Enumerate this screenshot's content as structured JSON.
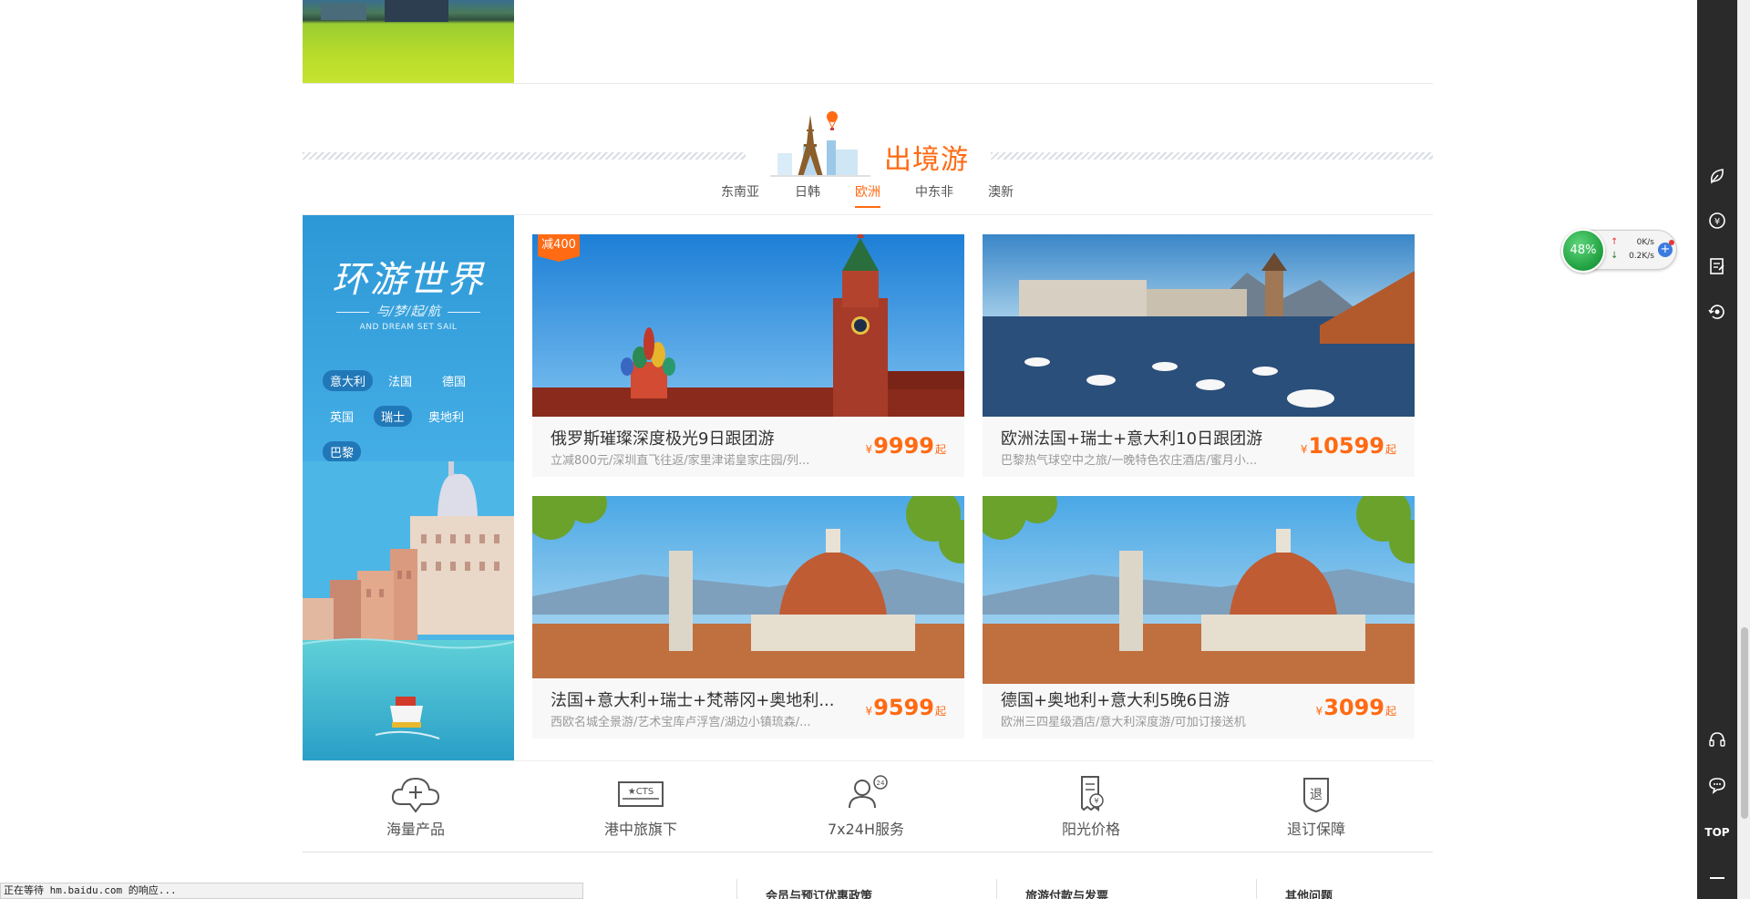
{
  "section": {
    "title": "出境游",
    "tabs": [
      {
        "label": "东南亚"
      },
      {
        "label": "日韩"
      },
      {
        "label": "欧洲",
        "active": true
      },
      {
        "label": "中东非"
      },
      {
        "label": "澳新"
      }
    ]
  },
  "promo": {
    "title": "环游世界",
    "subtitle": "与/梦/起/航",
    "subtitle_en": "AND DREAM SET SAIL",
    "tags": [
      {
        "label": "意大利",
        "selected": true
      },
      {
        "label": "法国"
      },
      {
        "label": "德国"
      },
      {
        "label": "英国"
      },
      {
        "label": "瑞士",
        "selected": true
      },
      {
        "label": "奥地利"
      },
      {
        "label": "巴黎",
        "selected": true
      }
    ]
  },
  "products": [
    {
      "badge": "减400",
      "name": "俄罗斯璀璨深度极光9日跟团游",
      "desc": "立减800元/深圳直飞往返/家里津诺皇家庄园/列...",
      "currency": "¥",
      "price": "9999",
      "suffix": "起",
      "scene": "moscow-kremlin"
    },
    {
      "name": "欧洲法国+瑞士+意大利10日跟团游",
      "desc": "巴黎热气球空中之旅/一晚特色农庄酒店/蜜月小...",
      "currency": "¥",
      "price": "10599",
      "suffix": "起",
      "scene": "lucerne-swans"
    },
    {
      "name": "法国+意大利+瑞士+梵蒂冈+奥地利...",
      "desc": "西欧名城全景游/艺术宝库卢浮宫/湖边小镇琉森/...",
      "currency": "¥",
      "price": "9599",
      "suffix": "起",
      "scene": "florence-duomo"
    },
    {
      "name": "德国+奥地利+意大利5晚6日游",
      "desc": "欧洲三四星级酒店/意大利深度游/可加订接送机",
      "currency": "¥",
      "price": "3099",
      "suffix": "起",
      "scene": "florence-duomo"
    }
  ],
  "services": [
    {
      "label": "海量产品",
      "icon": "cloud-plus-icon"
    },
    {
      "label": "港中旅旗下",
      "icon": "cts-card-icon"
    },
    {
      "label": "7x24H服务",
      "icon": "user-24h-icon"
    },
    {
      "label": "阳光价格",
      "icon": "receipt-yen-icon"
    },
    {
      "label": "退订保障",
      "icon": "refund-shield-icon"
    }
  ],
  "footer": {
    "links": [
      "会员与预订优惠政策",
      "旅游付款与发票",
      "其他问题"
    ]
  },
  "status_bar": {
    "text": "正在等待 hm.baidu.com 的响应..."
  },
  "net_widget": {
    "percent": "48%",
    "up": "0K/s",
    "down": "0.2K/s"
  },
  "toolbar": {
    "top_label": "TOP"
  },
  "colors": {
    "accent": "#ff6a13",
    "toolbar_bg": "#2a2a2a",
    "promo_blue": "#2d98d6"
  }
}
